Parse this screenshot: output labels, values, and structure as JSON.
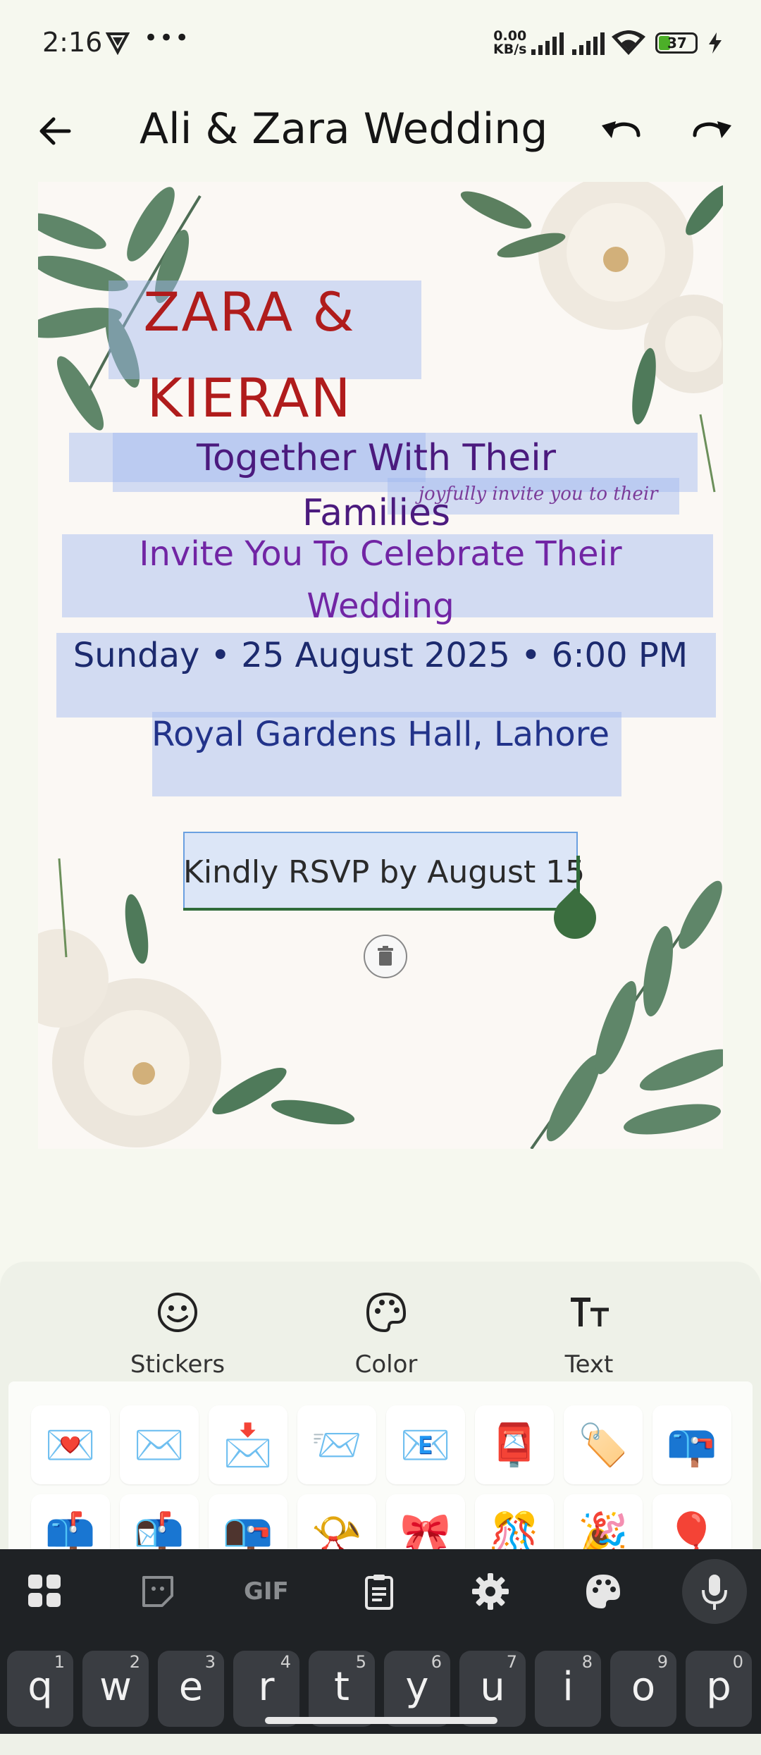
{
  "status_bar": {
    "time": "2:16",
    "overflow": "•••",
    "net_speed_value": "0.00",
    "net_speed_unit": "KB/s",
    "battery": "37"
  },
  "app_bar": {
    "title": "Ali & Zara Wedding"
  },
  "invitation": {
    "names_line1": "ZARA &",
    "names_line2": "KIERAN",
    "together_line1": "Together With Their",
    "together_line2": "Families",
    "joyfully": "joyfully invite you to their",
    "invite_line1": "Invite You To Celebrate Their",
    "invite_line2": "Wedding",
    "date_time": "Sunday • 25 August 2025 • 6:00 PM",
    "venue": "Royal Gardens Hall, Lahore",
    "rsvp": "Kindly RSVP by August 15"
  },
  "tools": [
    {
      "label": "Stickers",
      "icon": "smiley-icon"
    },
    {
      "label": "Color",
      "icon": "palette-icon"
    },
    {
      "label": "Text",
      "icon": "text-size-icon"
    }
  ],
  "stickers": {
    "row1": [
      "💌",
      "✉️",
      "📩",
      "📨",
      "📧",
      "📮",
      "🏷️",
      "📪"
    ],
    "row2": [
      "📫",
      "📬",
      "📭",
      "📯",
      "🎀",
      "🎊",
      "🎉",
      "🎈"
    ]
  },
  "keyboard": {
    "keys": [
      "q",
      "w",
      "e",
      "r",
      "t",
      "y",
      "u",
      "i",
      "o",
      "p"
    ],
    "hints": [
      "1",
      "2",
      "3",
      "4",
      "5",
      "6",
      "7",
      "8",
      "9",
      "0"
    ],
    "gif_label": "GIF"
  }
}
